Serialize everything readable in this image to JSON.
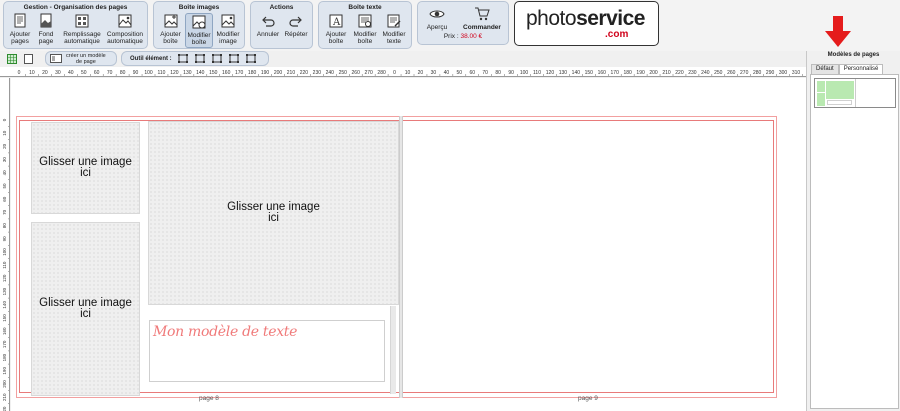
{
  "ribbon": {
    "gestion": {
      "title": "Gestion - Organisation des pages",
      "buttons": [
        {
          "label": "Ajouter\npages",
          "icon": "add-pages-icon"
        },
        {
          "label": "Fond\npage",
          "icon": "page-background-icon"
        },
        {
          "label": "Remplissage\nautomatique",
          "icon": "auto-fill-icon"
        },
        {
          "label": "Composition\nautomatique",
          "icon": "auto-layout-icon"
        }
      ]
    },
    "boite_images": {
      "title": "Boîte images",
      "buttons": [
        {
          "label": "Ajouter\nboîte",
          "icon": "add-image-box-icon"
        },
        {
          "label": "Modifier\nboîte",
          "icon": "edit-image-box-icon"
        },
        {
          "label": "Modifier\nimage",
          "icon": "edit-image-icon"
        }
      ]
    },
    "actions": {
      "title": "Actions",
      "buttons": [
        {
          "label": "Annuler",
          "icon": "undo-icon"
        },
        {
          "label": "Répéter",
          "icon": "redo-icon"
        }
      ]
    },
    "boite_texte": {
      "title": "Boîte texte",
      "buttons": [
        {
          "label": "Ajouter\nboîte",
          "icon": "add-text-box-icon"
        },
        {
          "label": "Modifier\nboîte",
          "icon": "edit-text-box-icon"
        },
        {
          "label": "Modifier\ntexte",
          "icon": "edit-text-icon"
        }
      ]
    },
    "apercu_label": "Aperçu",
    "commander_label": "Commander",
    "price_label": "Prix :",
    "price_value": "38.00 €",
    "logo_regular": "photo",
    "logo_bold": "service",
    "logo_com": ".com"
  },
  "toolbar2": {
    "create_model_label": "créer un modèle\nde page",
    "outil_label": "Outil élément :"
  },
  "ruler": {
    "h_labels_a": [
      "0",
      "10",
      "20",
      "30",
      "40",
      "50",
      "60",
      "70",
      "80",
      "90",
      "100",
      "110",
      "120",
      "130",
      "140",
      "150",
      "160",
      "170",
      "180",
      "190",
      "200",
      "210",
      "220",
      "230",
      "240",
      "250",
      "260",
      "270",
      "280",
      "0",
      "10",
      "20",
      "30",
      "40",
      "50",
      "60",
      "70",
      "80",
      "90",
      "100",
      "110",
      "120",
      "130",
      "140",
      "150",
      "160",
      "170",
      "180",
      "190",
      "200",
      "210",
      "220",
      "230",
      "240",
      "250",
      "260",
      "270",
      "280",
      "290",
      "300",
      "310"
    ],
    "v_labels": [
      "0",
      "10",
      "20",
      "30",
      "40",
      "50",
      "60",
      "70",
      "80",
      "90",
      "100",
      "110",
      "120",
      "130",
      "140",
      "150",
      "160",
      "170",
      "180",
      "190",
      "200",
      "210",
      "220"
    ]
  },
  "canvas": {
    "drop_text": "Glisser une image\nici",
    "text_model": "Mon modèle de texte",
    "page_left": "page 8",
    "page_right": "page 9"
  },
  "right_panel": {
    "title": "Modèles de pages",
    "tabs": [
      "Défaut",
      "Personnalisé"
    ],
    "active_tab": 1
  },
  "colors": {
    "accent_red": "#d0021b",
    "frame_red": "#e87a7a",
    "ribbon_group_bg": "#dfe6ef"
  }
}
